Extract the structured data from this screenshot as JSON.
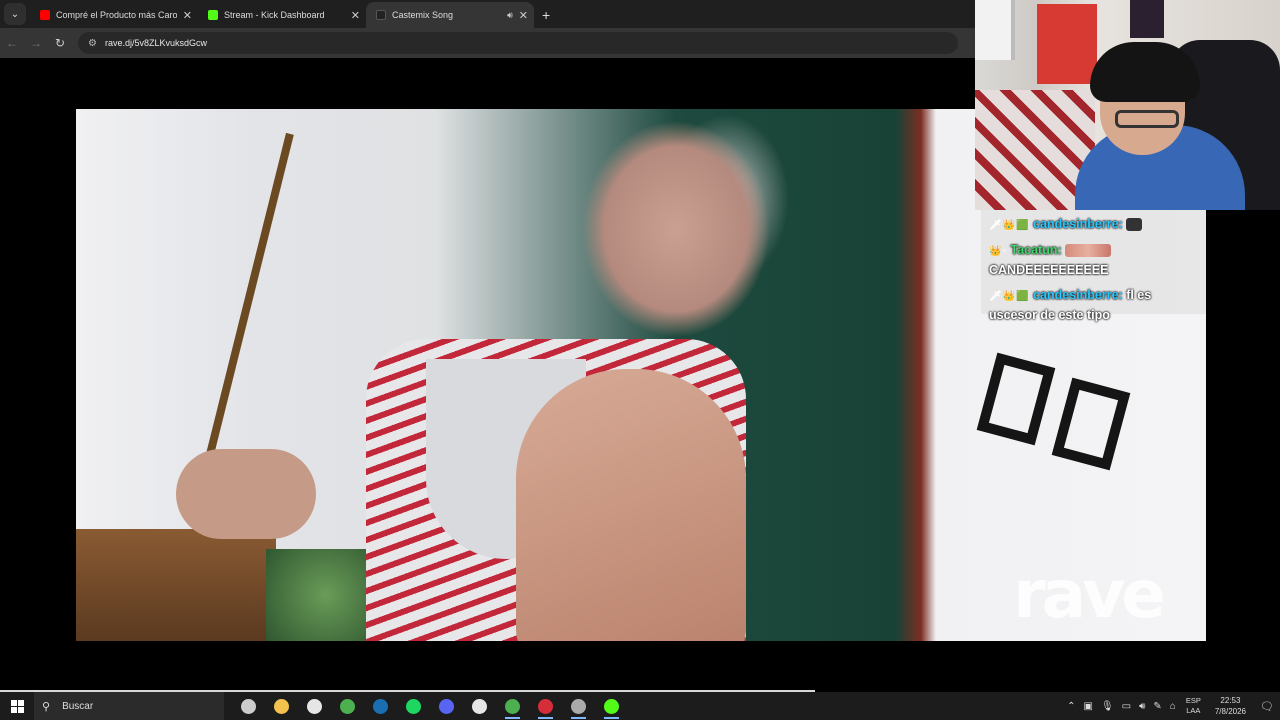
{
  "browser": {
    "tabs": [
      {
        "label": "Compré el Producto más Caro d",
        "favicon_color": "#ff0000",
        "active": false,
        "playing": false
      },
      {
        "label": "Stream - Kick Dashboard",
        "favicon_color": "#53fc18",
        "active": false,
        "playing": false
      },
      {
        "label": "Castemix Song",
        "favicon_color": "#333333",
        "active": true,
        "playing": true
      }
    ],
    "new_tab_label": "+",
    "url": "rave.dj/5v8ZLKvuksdGcw"
  },
  "video": {
    "watermark": "rave"
  },
  "chat": {
    "messages": [
      {
        "user": "candesinberre:",
        "text": "",
        "user_color": "#28c8ff"
      },
      {
        "user": "Tacatun:",
        "text": "CANDEEEEEEEEEE",
        "user_color": "#3fd66a"
      },
      {
        "user": "candesinberre:",
        "text": "fl es uscesor de este tipo",
        "user_color": "#28c8ff"
      }
    ]
  },
  "taskbar": {
    "search_placeholder": "Buscar",
    "apps": [
      {
        "name": "task-view",
        "color": "#cccccc",
        "open": false
      },
      {
        "name": "file-explorer",
        "color": "#f2c14e",
        "open": false
      },
      {
        "name": "app-s",
        "color": "#e6e6e6",
        "open": false
      },
      {
        "name": "chrome",
        "color": "#4caf50",
        "open": false
      },
      {
        "name": "steam",
        "color": "#1b6fb0",
        "open": false
      },
      {
        "name": "spotify",
        "color": "#1ed760",
        "open": false
      },
      {
        "name": "discord",
        "color": "#5865f2",
        "open": false
      },
      {
        "name": "app-s2",
        "color": "#e6e6e6",
        "open": false
      },
      {
        "name": "chrome-active",
        "color": "#4caf50",
        "open": true
      },
      {
        "name": "app-red",
        "color": "#d62d3a",
        "open": true
      },
      {
        "name": "obs",
        "color": "#aaaaaa",
        "open": true
      },
      {
        "name": "kick",
        "color": "#53fc18",
        "open": true
      }
    ],
    "lang_top": "ESP",
    "lang_bottom": "LAA",
    "time": "22:53",
    "date": "7/8/2026"
  }
}
